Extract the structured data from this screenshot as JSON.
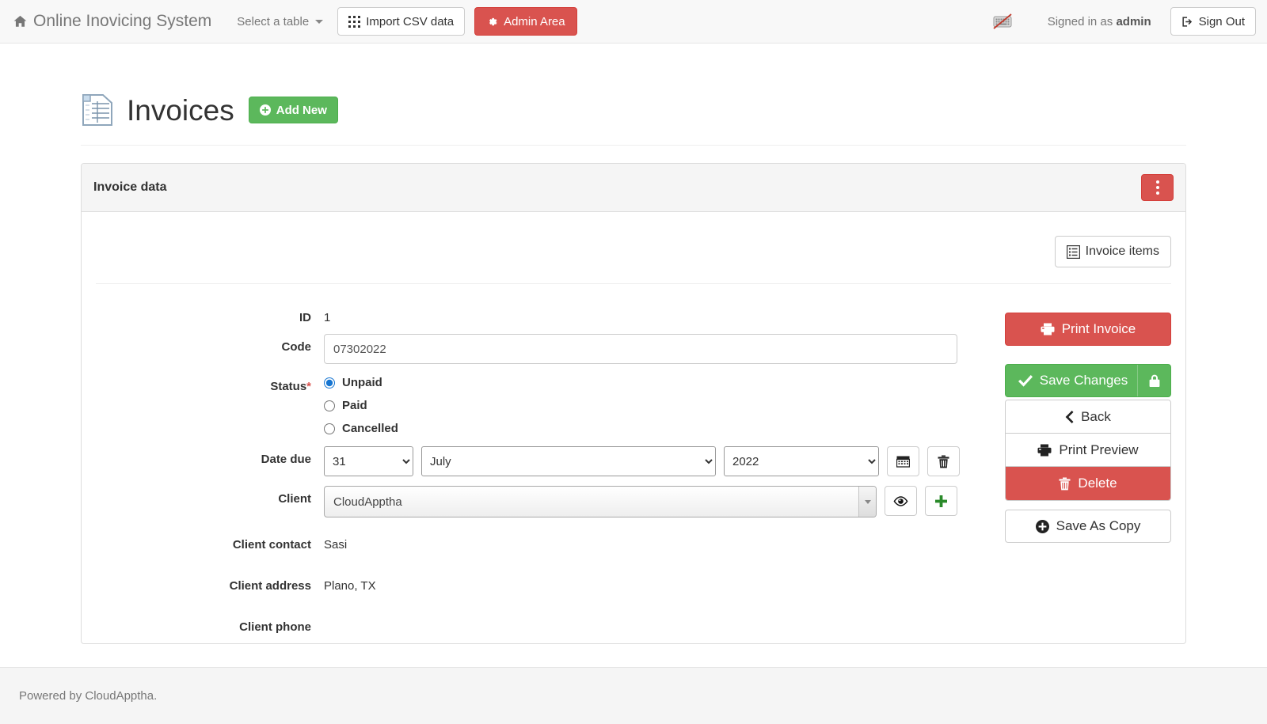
{
  "navbar": {
    "brand": "Online Inovicing System",
    "brand_icon": "home-icon",
    "table_select_label": "Select a table",
    "import_csv_label": "Import CSV data",
    "import_csv_icon": "grid-icon",
    "admin_area_label": "Admin Area",
    "admin_area_icon": "gear-icon",
    "keyboard_icon": "keyboard-disabled-icon",
    "signed_in_prefix": "Signed in as",
    "signed_in_user": "admin",
    "sign_out_label": "Sign Out",
    "sign_out_icon": "sign-out-icon"
  },
  "page": {
    "title": "Invoices",
    "title_icon": "table-document-icon",
    "add_new_label": "Add New",
    "add_new_icon": "plus-circle-icon"
  },
  "panel": {
    "heading": "Invoice data",
    "kebab_icon": "vertical-dots-icon",
    "invoice_items_label": "Invoice items",
    "invoice_items_icon": "list-icon"
  },
  "form": {
    "id": {
      "label": "ID",
      "value": "1"
    },
    "code": {
      "label": "Code",
      "value": "07302022",
      "placeholder": ""
    },
    "status": {
      "label": "Status",
      "required_mark": "*",
      "options": [
        "Unpaid",
        "Paid",
        "Cancelled"
      ],
      "selected": "Unpaid"
    },
    "date_due": {
      "label": "Date due",
      "day": "31",
      "month": "July",
      "year": "2022",
      "calendar_icon": "calendar-icon",
      "clear_icon": "trash-icon"
    },
    "client": {
      "label": "Client",
      "value": "CloudApptha",
      "view_icon": "eye-icon",
      "add_icon": "plus-icon"
    },
    "client_contact": {
      "label": "Client contact",
      "value": "Sasi"
    },
    "client_address": {
      "label": "Client address",
      "value": "Plano, TX"
    },
    "client_phone": {
      "label": "Client phone",
      "value": ""
    }
  },
  "actions": {
    "print_invoice": {
      "label": "Print Invoice",
      "icon": "printer-icon"
    },
    "save_changes": {
      "label": "Save Changes",
      "icon": "check-icon",
      "lock_icon": "lock-icon"
    },
    "back": {
      "label": "Back",
      "icon": "chevron-left-icon"
    },
    "print_preview": {
      "label": "Print Preview",
      "icon": "printer-icon"
    },
    "delete": {
      "label": "Delete",
      "icon": "trash-icon"
    },
    "save_as_copy": {
      "label": "Save As Copy",
      "icon": "plus-circle-icon"
    }
  },
  "footer": {
    "text": "Powered by CloudApptha."
  },
  "colors": {
    "danger": "#d9534f",
    "success": "#5cb85c",
    "navbar_bg": "#f8f8f8",
    "panel_head_bg": "#f5f5f5",
    "text": "#333333",
    "muted": "#777777",
    "radio_accent": "#1675d1"
  }
}
